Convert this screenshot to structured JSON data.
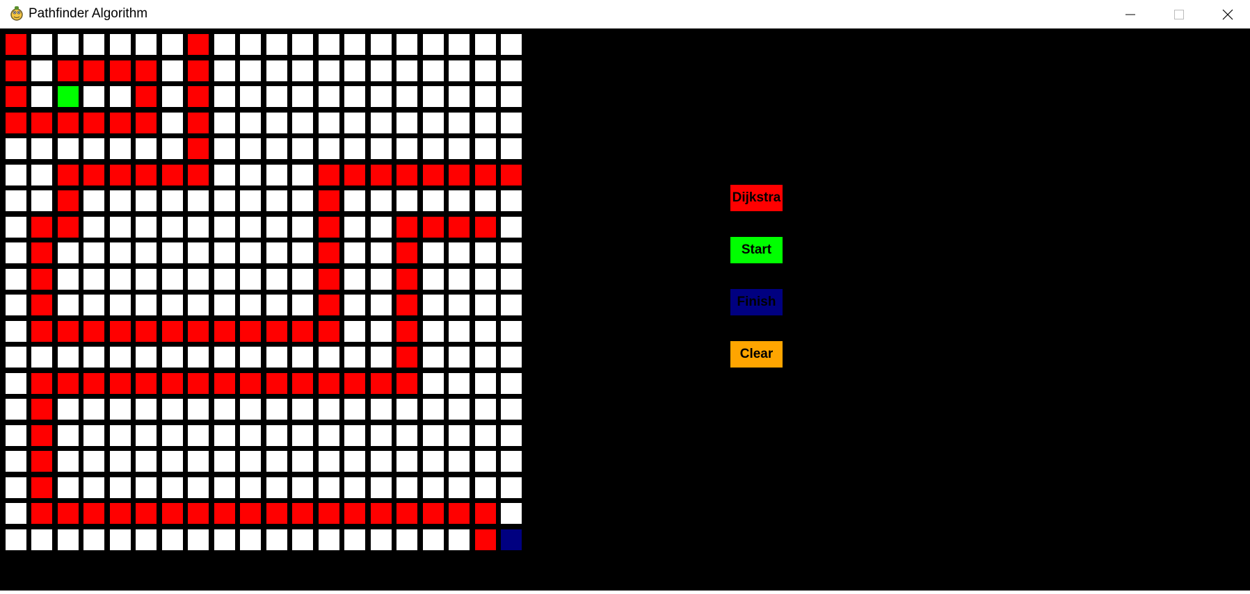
{
  "window": {
    "title": "Pathfinder Algorithm",
    "app_icon": "pygame-snake-icon",
    "controls": [
      "minimize-icon",
      "maximize-icon",
      "close-icon"
    ]
  },
  "grid": {
    "rows": 20,
    "cols": 20,
    "colors": {
      "empty": "#ffffff",
      "wall": "#ff0000",
      "start": "#00ff00",
      "finish": "#000080",
      "background": "#000000"
    },
    "legend": {
      "W": "wall",
      "S": "start",
      "F": "finish",
      ".": "empty"
    },
    "cells": [
      "W......W............",
      "W.WWWW.W............",
      "W.S..W.W............",
      "WWWWWW.W............",
      ".......W............",
      "..WWWWWW....WWWWWWWW",
      "..W.........W.......",
      ".WW.........W..WWWW.",
      ".W..........W..W....",
      ".W..........W..W....",
      ".W..........W..W....",
      ".WWWWWWWWWWWW..W....",
      "...............W....",
      ".WWWWWWWWWWWWWWW....",
      ".W..................",
      ".W..................",
      ".W..................",
      ".W..................",
      ".WWWWWWWWWWWWWWWWWW.",
      "..................WF"
    ]
  },
  "buttons": [
    {
      "key": "dijkstra",
      "label": "Dijkstra",
      "color": "#ff0000"
    },
    {
      "key": "start",
      "label": "Start",
      "color": "#00ff00"
    },
    {
      "key": "finish",
      "label": "Finish",
      "color": "#000080"
    },
    {
      "key": "clear",
      "label": "Clear",
      "color": "#ffa500"
    }
  ]
}
